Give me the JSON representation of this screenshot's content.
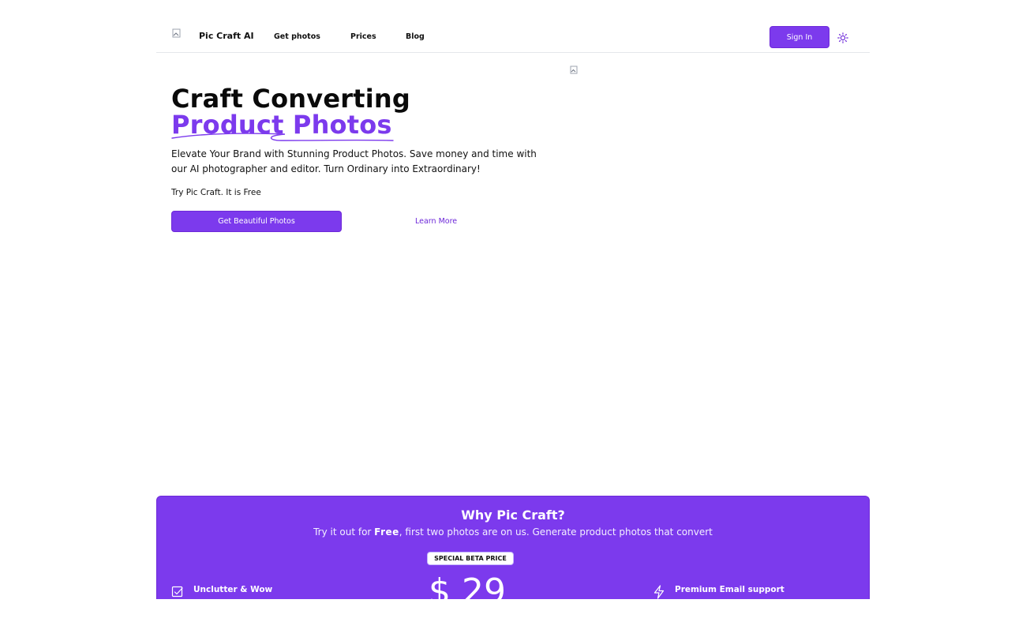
{
  "header": {
    "brand": "Pic Craft AI",
    "nav": [
      "Get photos",
      "Prices",
      "Blog"
    ],
    "sign_in": "Sign In"
  },
  "hero": {
    "title_line1": "Craft Converting",
    "title_line2": "Product Photos",
    "description": "Elevate Your Brand with Stunning Product Photos. Save money and time with our AI photographer and editor. Turn Ordinary into Extraordinary!",
    "try_text": "Try Pic Craft. It is Free",
    "cta_label": "Get Beautiful Photos",
    "learn_more": "Learn More"
  },
  "why": {
    "title": "Why Pic Craft?",
    "subtitle_prefix": "Try it out for ",
    "subtitle_bold": "Free",
    "subtitle_suffix": ", first two photos are on us. Generate product photos that convert",
    "badge": "SPECIAL BETA PRICE",
    "price": "$ 29",
    "features": [
      {
        "title": "Unclutter & Wow",
        "description": "",
        "icon": "checkbox-icon"
      },
      {
        "title": "Premium Email support",
        "description": "",
        "icon": "lightning-icon"
      }
    ]
  },
  "colors": {
    "accent": "#7c3aed",
    "accent_border": "#6d28d9"
  }
}
